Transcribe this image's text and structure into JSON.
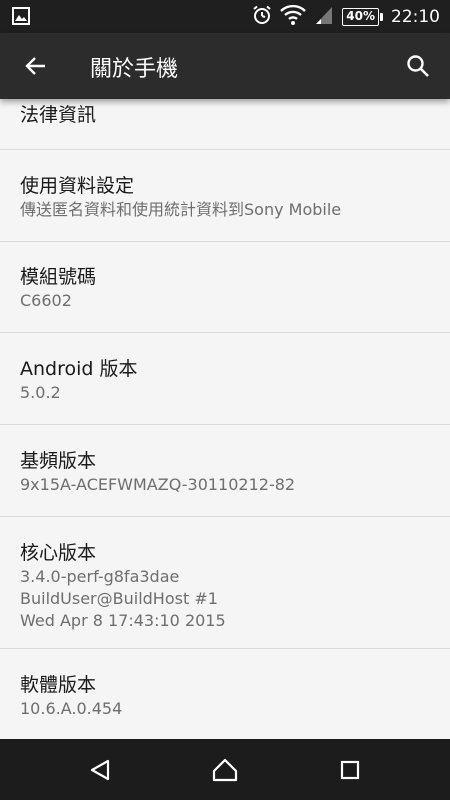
{
  "status_bar": {
    "time": "22:10",
    "battery": "40%",
    "icons": [
      "image-notification-icon",
      "alarm-icon",
      "wifi-icon",
      "signal-icon",
      "battery-icon"
    ]
  },
  "app_bar": {
    "title": "關於手機",
    "back_icon": "arrow-left-icon",
    "search_icon": "search-icon"
  },
  "items": {
    "legal": {
      "title": "法律資訊"
    },
    "usage": {
      "title": "使用資料設定",
      "summary": "傳送匿名資料和使用統計資料到Sony Mobile"
    },
    "model": {
      "title": "模組號碼",
      "summary": "C6602"
    },
    "android": {
      "title": "Android 版本",
      "summary": "5.0.2"
    },
    "baseband": {
      "title": "基頻版本",
      "summary": "9x15A-ACEFWMAZQ-30110212-82"
    },
    "kernel": {
      "title": "核心版本",
      "line1": "3.4.0-perf-g8fa3dae",
      "line2": "BuildUser@BuildHost #1",
      "line3": "Wed Apr 8 17:43:10 2015"
    },
    "software": {
      "title": "軟體版本",
      "summary": "10.6.A.0.454"
    }
  },
  "nav_bar": {
    "icons": [
      "back-triangle-icon",
      "home-icon",
      "recents-icon"
    ]
  },
  "colors": {
    "status_bar": "#1f1f1f",
    "app_bar": "#2c2c2c",
    "background": "#f5f5f5",
    "divider": "#dadada",
    "title_text": "#1a1a1a",
    "summary_text": "#6e6e6e",
    "nav_bar": "#1c1c1c"
  }
}
